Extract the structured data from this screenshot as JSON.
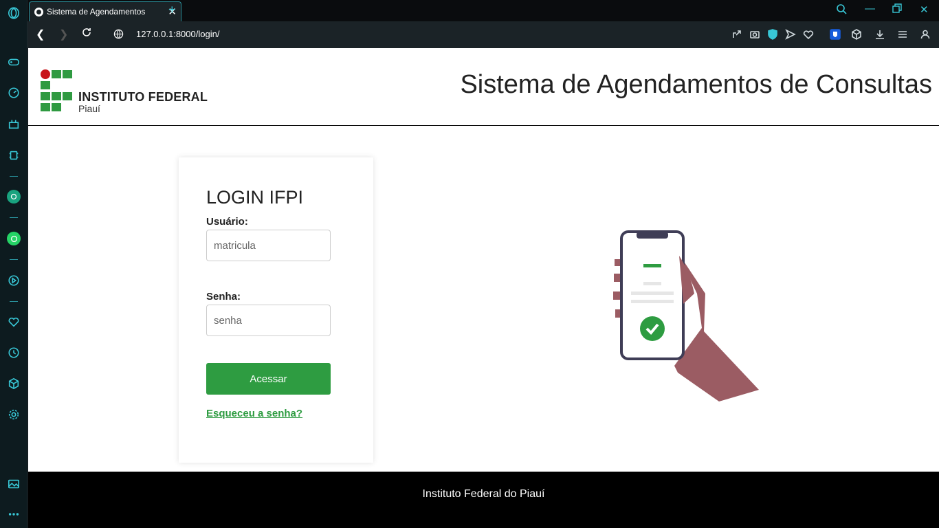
{
  "browser": {
    "tab_title": "Sistema de Agendamentos",
    "url": "127.0.0.1:8000/login/"
  },
  "header": {
    "logo_name": "INSTITUTO FEDERAL",
    "logo_sub": "Piauí",
    "site_title": "Sistema de Agendamentos de Consultas"
  },
  "login": {
    "title": "LOGIN IFPI",
    "user_label": "Usuário:",
    "user_placeholder": "matricula",
    "password_label": "Senha:",
    "password_placeholder": "senha",
    "submit_label": "Acessar",
    "forgot_label": "Esqueceu a senha?"
  },
  "footer": {
    "text": "Instituto Federal do Piauí"
  },
  "colors": {
    "brand_green": "#2e9c41",
    "logo_red": "#c8151b",
    "browser_accent": "#38c7d6"
  }
}
